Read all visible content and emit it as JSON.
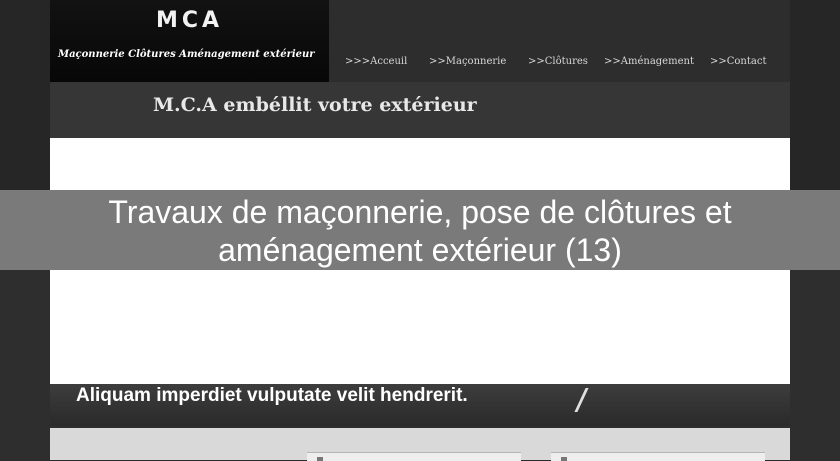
{
  "logo": {
    "title": "MCA",
    "subtitle": "Maçonnerie Clôtures Aménagement extérieur"
  },
  "nav": {
    "items": [
      {
        "label": ">>>Acceuil"
      },
      {
        "label": ">>Maçonnerie"
      },
      {
        "label": ">>Clôtures"
      },
      {
        "label": ">>Aménagement"
      },
      {
        "label": ">>Contact"
      }
    ]
  },
  "tagline": "M.C.A embéllit votre extérieur",
  "headline": "Travaux de maçonnerie, pose de clôtures et aménagement extérieur (13)",
  "slider": {
    "caption": "Aliquam imperdiet vulputate velit hendrerit."
  }
}
